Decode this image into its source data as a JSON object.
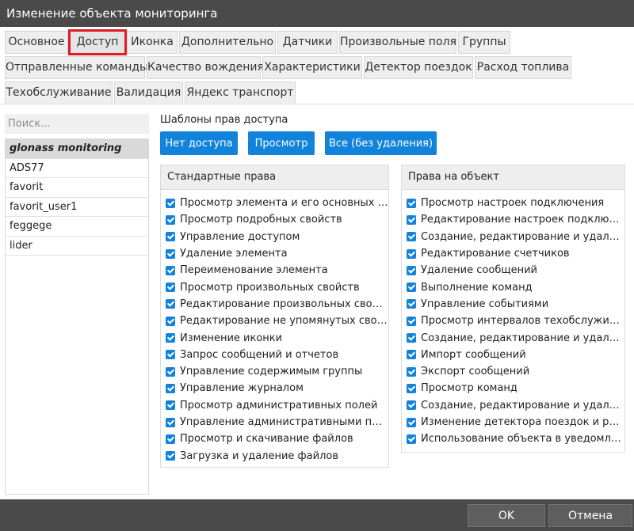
{
  "window": {
    "title": "Изменение объекта мониторинга"
  },
  "tabs": [
    {
      "label": "Основное"
    },
    {
      "label": "Доступ"
    },
    {
      "label": "Иконка"
    },
    {
      "label": "Дополнительно"
    },
    {
      "label": "Датчики"
    },
    {
      "label": "Произвольные поля"
    },
    {
      "label": "Группы"
    },
    {
      "label": "Отправленные команды"
    },
    {
      "label": "Качество вождения"
    },
    {
      "label": "Характеристики"
    },
    {
      "label": "Детектор поездок"
    },
    {
      "label": "Расход топлива"
    },
    {
      "label": "Техобслуживание"
    },
    {
      "label": "Валидация"
    },
    {
      "label": "Яндекс транспорт"
    }
  ],
  "search": {
    "placeholder": "Поиск..."
  },
  "users": [
    {
      "name": "glonass monitoring"
    },
    {
      "name": "ADS77"
    },
    {
      "name": "favorit"
    },
    {
      "name": "favorit_user1"
    },
    {
      "name": "feggege"
    },
    {
      "name": "lider"
    }
  ],
  "templates": {
    "label": "Шаблоны прав доступа",
    "buttons": [
      {
        "label": "Нет доступа"
      },
      {
        "label": "Просмотр"
      },
      {
        "label": "Все (без удаления)"
      }
    ]
  },
  "standard_rights": {
    "title": "Стандартные права",
    "items": [
      {
        "label": "Просмотр элемента и его основных св...",
        "checked": true
      },
      {
        "label": "Просмотр подробных свойств",
        "checked": true
      },
      {
        "label": "Управление доступом",
        "checked": true
      },
      {
        "label": "Удаление элемента",
        "checked": true
      },
      {
        "label": "Переименование элемента",
        "checked": true
      },
      {
        "label": "Просмотр произвольных свойств",
        "checked": true
      },
      {
        "label": "Редактирование произвольных свойств",
        "checked": true
      },
      {
        "label": "Редактирование не упомянутых свойств",
        "checked": true
      },
      {
        "label": "Изменение иконки",
        "checked": true
      },
      {
        "label": "Запрос сообщений и отчетов",
        "checked": true
      },
      {
        "label": "Управление содержимым группы",
        "checked": true
      },
      {
        "label": "Управление журналом",
        "checked": true
      },
      {
        "label": "Просмотр административных полей",
        "checked": true
      },
      {
        "label": "Управление административными поля...",
        "checked": true
      },
      {
        "label": "Просмотр и скачивание файлов",
        "checked": true
      },
      {
        "label": "Загрузка и удаление файлов",
        "checked": true
      }
    ]
  },
  "object_rights": {
    "title": "Права на объект",
    "items": [
      {
        "label": "Просмотр настроек подключения",
        "checked": true
      },
      {
        "label": "Редактирование настроек подключения",
        "checked": true
      },
      {
        "label": "Создание, редактирование и удаление...",
        "checked": true
      },
      {
        "label": "Редактирование счетчиков",
        "checked": true
      },
      {
        "label": "Удаление сообщений",
        "checked": true
      },
      {
        "label": "Выполнение команд",
        "checked": true
      },
      {
        "label": "Управление событиями",
        "checked": true
      },
      {
        "label": "Просмотр интервалов техобслуживания",
        "checked": true
      },
      {
        "label": "Создание, редактирование и удаление...",
        "checked": true
      },
      {
        "label": "Импорт сообщений",
        "checked": true
      },
      {
        "label": "Экспорт сообщений",
        "checked": true
      },
      {
        "label": "Просмотр команд",
        "checked": true
      },
      {
        "label": "Создание, редактирование и удаление...",
        "checked": true
      },
      {
        "label": "Изменение детектора поездок и расхо...",
        "checked": true
      },
      {
        "label": "Использование объекта в уведомлени...",
        "checked": true
      }
    ]
  },
  "footer": {
    "ok_label": "OK",
    "cancel_label": "Отмена"
  },
  "colors": {
    "accent": "#1283da",
    "highlight": "#e01b24",
    "chrome": "#4a4a4a"
  }
}
